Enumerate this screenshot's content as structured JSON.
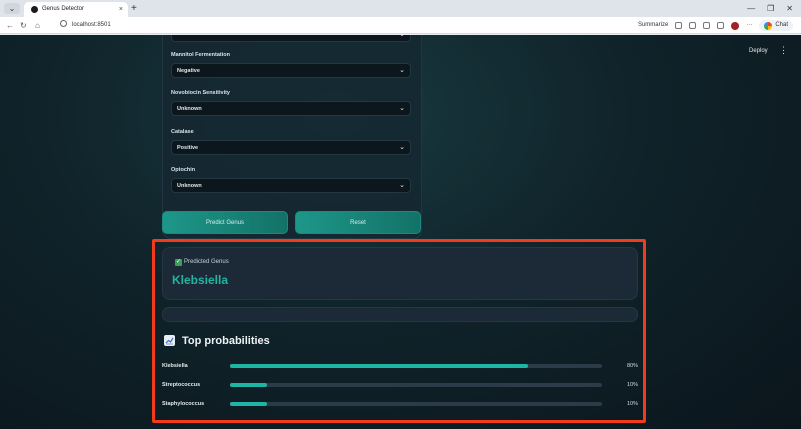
{
  "browser": {
    "tab_title": "Genus Detector",
    "tab_close": "×",
    "new_tab": "+",
    "address": "localhost:8501",
    "summarize_label": "Summarize",
    "profile_label": "Chat",
    "minimize": "—",
    "restore": "❐",
    "close": "✕"
  },
  "app": {
    "deploy_label": "Deploy",
    "menu_glyph": "⋮"
  },
  "form": {
    "fields": [
      {
        "label": "Mannitol Fermentation",
        "value": "Negative"
      },
      {
        "label": "Novobiocin Sensitivity",
        "value": "Unknown"
      },
      {
        "label": "Catalase",
        "value": "Positive"
      },
      {
        "label": "Optochin",
        "value": "Unknown"
      }
    ],
    "predict_label": "Predict Genus",
    "reset_label": "Reset"
  },
  "result": {
    "predicted_label": "Predicted Genus",
    "predicted_value": "Klebsiella",
    "top_title": "Top probabilities",
    "probabilities": [
      {
        "name": "Klebsiella",
        "percent_text": "80%",
        "fraction": 0.8
      },
      {
        "name": "Streptococcus",
        "percent_text": "10%",
        "fraction": 0.1
      },
      {
        "name": "Staphylococcus",
        "percent_text": "10%",
        "fraction": 0.1
      }
    ]
  },
  "colors": {
    "accent": "#1fb5a5",
    "highlight_frame": "#f23a1c",
    "background": "#0f1e25"
  },
  "icons": {
    "check": "checkbox-check-icon",
    "chart": "chart-increasing-icon",
    "chevron": "chevron-down-icon"
  }
}
